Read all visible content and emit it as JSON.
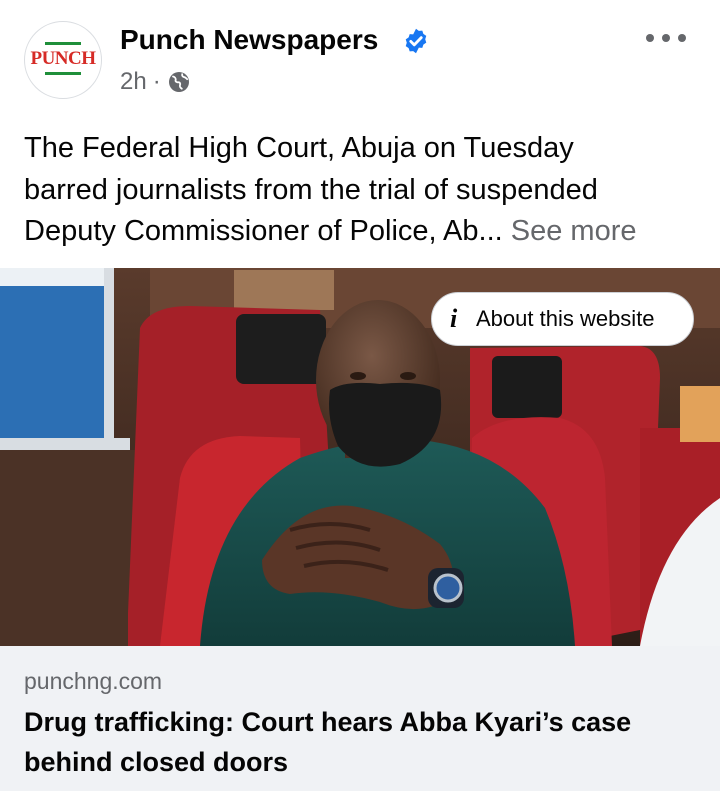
{
  "post": {
    "author": "Punch Newspapers",
    "avatar_logo": "PUNCH",
    "timestamp": "2h",
    "separator": "·",
    "audience_icon": "globe-icon",
    "verified_icon": "verified-badge-icon",
    "more_icon": "more-options-icon",
    "text_line1": "The Federal High Court, Abuja on Tuesday",
    "text_line2": "barred journalists from the trial of suspended",
    "text_line3": "Deputy Commissioner of Police, Ab...",
    "see_more": "See more"
  },
  "link_preview": {
    "about_label": "About this website",
    "domain": "punchng.com",
    "headline": "Drug trafficking: Court hears Abba Kyari’s case behind closed doors"
  },
  "colors": {
    "verified_blue": "#1877f2",
    "secondary_text": "#65676b",
    "card_background": "#f0f2f5",
    "logo_red": "#d62b26",
    "logo_green": "#1f8f3a"
  }
}
